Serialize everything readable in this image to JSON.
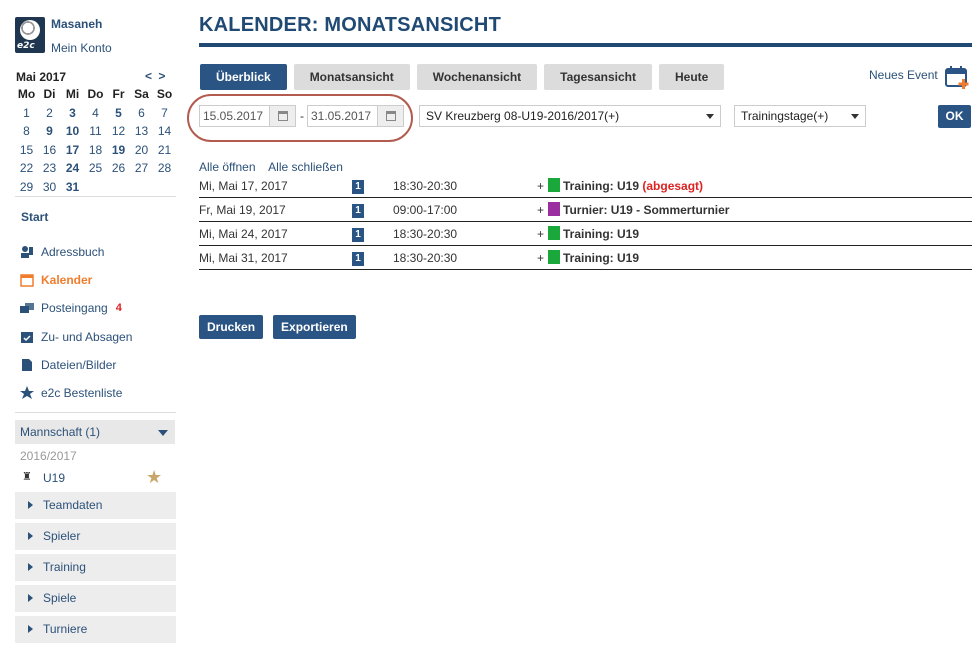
{
  "user": {
    "name": "Masaneh",
    "account_link": "Mein Konto",
    "logo_text": "e2c"
  },
  "mini_calendar": {
    "title": "Mai 2017",
    "prev": "<",
    "next": ">",
    "weekdays": [
      "Mo",
      "Di",
      "Mi",
      "Do",
      "Fr",
      "Sa",
      "So"
    ],
    "weeks": [
      [
        "",
        "1",
        "2",
        "3",
        "4",
        "5",
        "6",
        "7"
      ],
      [
        "8",
        "9",
        "10",
        "11",
        "12",
        "13",
        "14"
      ],
      [
        "15",
        "16",
        "17",
        "18",
        "19",
        "20",
        "21"
      ],
      [
        "22",
        "23",
        "24",
        "25",
        "26",
        "27",
        "28"
      ],
      [
        "29",
        "30",
        "31",
        "",
        "",
        "",
        ""
      ]
    ],
    "bold_days": [
      "3",
      "5",
      "9",
      "10",
      "17",
      "19",
      "24",
      "31"
    ]
  },
  "nav": {
    "start": "Start",
    "items": [
      {
        "label": "Adressbuch",
        "icon": "address-book-icon"
      },
      {
        "label": "Kalender",
        "icon": "calendar-icon",
        "active": true
      },
      {
        "label": "Posteingang",
        "icon": "inbox-icon",
        "badge": "4"
      },
      {
        "label": "Zu- und Absagen",
        "icon": "checkbox-calendar-icon"
      },
      {
        "label": "Dateien/Bilder",
        "icon": "file-icon"
      },
      {
        "label": "e2c Bestenliste",
        "icon": "star-icon"
      }
    ]
  },
  "team": {
    "header": "Mannschaft (1)",
    "season": "2016/2017",
    "name": "U19",
    "subitems": [
      "Teamdaten",
      "Spieler",
      "Training",
      "Spiele",
      "Turniere"
    ]
  },
  "page": {
    "title": "KALENDER: MONATSANSICHT"
  },
  "tabs": [
    "Überblick",
    "Monatsansicht",
    "Wochenansicht",
    "Tagesansicht",
    "Heute"
  ],
  "new_event_label": "Neues Event",
  "filters": {
    "date_from": "15.05.2017",
    "date_to": "31.05.2017",
    "dash": "-",
    "team_select": "SV Kreuzberg 08-U19-2016/2017(+)",
    "type_select": "Trainingstage(+)",
    "ok_label": "OK"
  },
  "links": {
    "open_all": "Alle öffnen",
    "close_all": "Alle schließen"
  },
  "events": [
    {
      "date": "Mi, Mai 17, 2017",
      "count": "1",
      "time": "18:30-20:30",
      "plus": "+",
      "color": "#1aa83a",
      "title": "Training: U19",
      "extra": "(abgesagt)"
    },
    {
      "date": "Fr, Mai 19, 2017",
      "count": "1",
      "time": "09:00-17:00",
      "plus": "+",
      "color": "#9b2fa0",
      "title": "Turnier: U19 - Sommerturnier",
      "extra": ""
    },
    {
      "date": "Mi, Mai 24, 2017",
      "count": "1",
      "time": "18:30-20:30",
      "plus": "+",
      "color": "#1aa83a",
      "title": "Training: U19",
      "extra": ""
    },
    {
      "date": "Mi, Mai 31, 2017",
      "count": "1",
      "time": "18:30-20:30",
      "plus": "+",
      "color": "#1aa83a",
      "title": "Training: U19",
      "extra": ""
    }
  ],
  "actions": {
    "print": "Drucken",
    "export": "Exportieren"
  },
  "colors": {
    "primary": "#2a5483",
    "active_nav": "#f07d2e",
    "alert": "#dd2222",
    "annotation": "#b25b4e"
  }
}
